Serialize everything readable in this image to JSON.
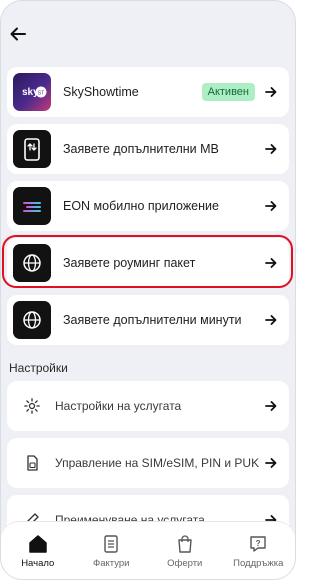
{
  "nav": {
    "back_icon": "arrow-left-icon"
  },
  "items": [
    {
      "label": "SkyShowtime",
      "badge": "Активен",
      "icon": "skyshowtime-logo"
    },
    {
      "label": "Заявете допълнителни МВ",
      "icon": "phone-data-icon"
    },
    {
      "label": "EON мобилно приложение",
      "icon": "eon-app-icon"
    },
    {
      "label": "Заявете роуминг пакет",
      "icon": "globe-icon"
    },
    {
      "label": "Заявете допълнителни минути",
      "icon": "globe-icon"
    }
  ],
  "settings": {
    "title": "Настройки",
    "items": [
      {
        "label": "Настройки на услугата",
        "icon": "gear-icon"
      },
      {
        "label": "Управление на SIM/eSIM, PIN и PUK",
        "icon": "sim-card-icon"
      },
      {
        "label": "Преименуване на услугата",
        "icon": "pencil-icon"
      }
    ]
  },
  "tabbar": [
    {
      "label": "Начало",
      "icon": "home-icon",
      "active": true
    },
    {
      "label": "Фактури",
      "icon": "invoice-icon"
    },
    {
      "label": "Оферти",
      "icon": "shopping-bag-icon"
    },
    {
      "label": "Поддръжка",
      "icon": "help-chat-icon"
    }
  ],
  "colors": {
    "badge_bg": "#aeeec4",
    "highlight": "#e0111c",
    "background": "#eef0f6"
  }
}
